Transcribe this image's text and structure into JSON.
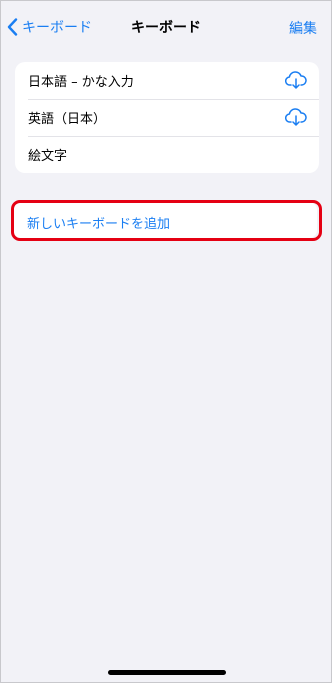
{
  "nav": {
    "back_label": "キーボード",
    "title": "キーボード",
    "edit_label": "編集"
  },
  "keyboards": [
    {
      "label": "日本語 – かな入力",
      "icon": "cloud-download-icon"
    },
    {
      "label": "英語（日本）",
      "icon": "cloud-download-icon"
    },
    {
      "label": "絵文字"
    }
  ],
  "add_keyboard_label": "新しいキーボードを追加",
  "colors": {
    "accent": "#1a7ef2",
    "background": "#f2f2f7",
    "highlight": "#e50013"
  }
}
